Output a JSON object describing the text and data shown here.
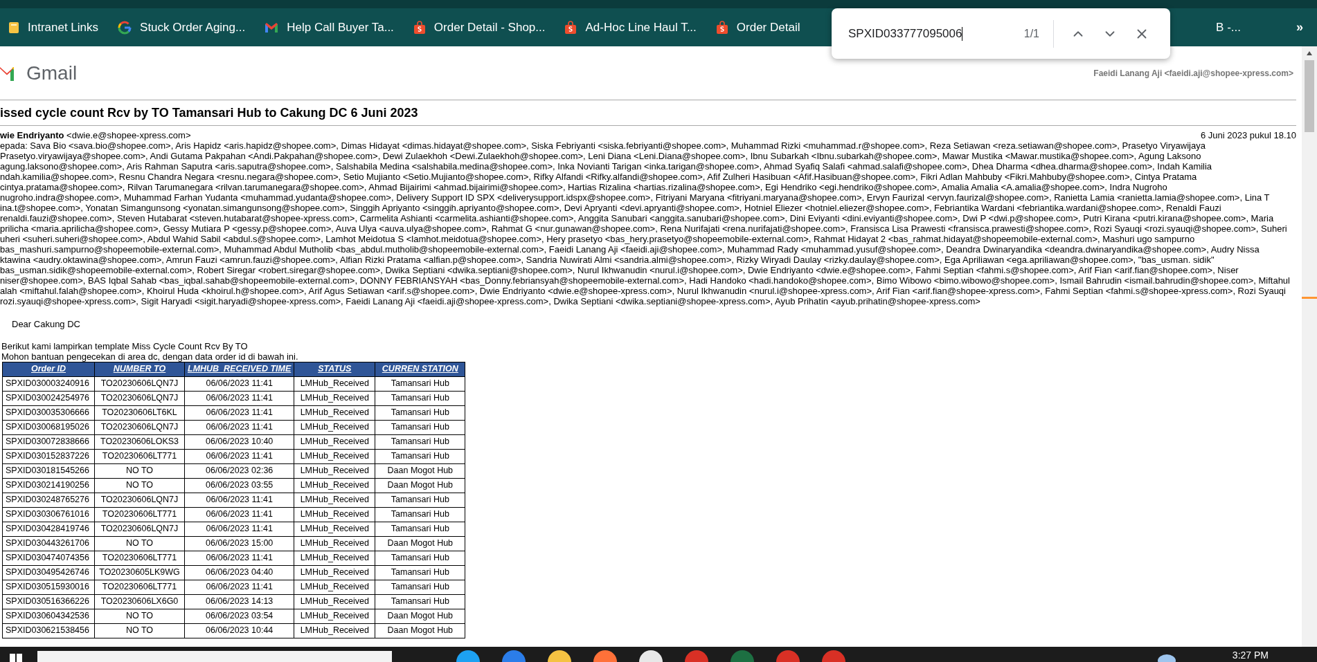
{
  "bookmarks": [
    {
      "kind": "folder",
      "label": "Intranet Links"
    },
    {
      "kind": "google",
      "label": "Stuck Order Aging..."
    },
    {
      "kind": "gmail",
      "label": "Help Call Buyer Ta..."
    },
    {
      "kind": "shop",
      "label": "Order Detail - Shop..."
    },
    {
      "kind": "shop",
      "label": "Ad-Hoc Line Haul T..."
    },
    {
      "kind": "shop",
      "label": "Order Detail"
    }
  ],
  "bookmark_tail": "B -...",
  "bookmark_overflow": "»",
  "find_bar": {
    "query": "SPXID033777095006",
    "count": "1/1"
  },
  "gmail": {
    "brand": "Gmail",
    "account": "Faeidi Lanang Aji <faeidi.aji@shopee-xpress.com>"
  },
  "email": {
    "subject": "issed cycle count Rcv by TO Tamansari Hub to Cakung DC 6 Juni 2023",
    "sender_name": "wie Endriyanto",
    "sender_address": "<dwie.e@shopee-xpress.com>",
    "date": "6 Juni 2023 pukul 18.10",
    "recipient_lines": [
      "epada: Sava Bio <sava.bio@shopee.com>, Aris Hapidz <aris.hapidz@shopee.com>, Dimas Hidayat <dimas.hidayat@shopee.com>, Siska Febriyanti <siska.febriyanti@shopee.com>, Muhammad Rizki <muhammad.r@shopee.com>, Reza Setiawan <reza.setiawan@shopee.com>, Prasetyo Viryawijaya",
      "Prasetyo.viryawijaya@shopee.com>, Andi Gutama Pakpahan <Andi.Pakpahan@shopee.com>, Dewi Zulaekhoh <Dewi.Zulaekhoh@shopee.com>, Leni Diana <Leni.Diana@shopee.com>, Ibnu Subarkah <Ibnu.subarkah@shopee.com>, Mawar Mustika <Mawar.mustika@shopee.com>, Agung Laksono",
      "agung.laksono@shopee.com>, Aris Rahman Saputra <aris.saputra@shopee.com>, Salshabila Medina <salshabila.medina@shopee.com>, Inka Novianti Tarigan <inka.tarigan@shopee.com>, Ahmad Syafiq Salafi <ahmad.salafi@shopee.com>, Dhea Dharma <dhea.dharma@shopee.com>, Indah Kamilia",
      "ndah.kamilia@shopee.com>, Resnu Chandra Negara <resnu.negara@shopee.com>, Setio Mujianto <Setio.Mujianto@shopee.com>, Rifky Alfandi <Rifky.alfandi@shopee.com>, Afif Zulheri Hasibuan <Afif.Hasibuan@shopee.com>, Fikri Adlan Mahbuby <Fikri.Mahbuby@shopee.com>, Cintya Pratama",
      "cintya.pratama@shopee.com>, Rilvan Tarumanegara <rilvan.tarumanegara@shopee.com>, Ahmad Bijairimi <ahmad.bijairimi@shopee.com>, Hartias Rizalina <hartias.rizalina@shopee.com>, Egi Hendriko <egi.hendriko@shopee.com>, Amalia Amalia <A.amalia@shopee.com>, Indra Nugroho",
      "nugroho.indra@shopee.com>, Muhammad Farhan Yudanta <muhammad.yudanta@shopee.com>, Delivery Support ID SPX <deliverysupport.idspx@shopee.com>, Fitriyani Maryana <fitriyani.maryana@shopee.com>, Ervyn Faurizal <ervyn.faurizal@shopee.com>, Ranietta Lamia <ranietta.lamia@shopee.com>, Lina T",
      "ina.t@shopee.com>, Yonatan Simangunsong <yonatan.simangunsong@shopee.com>, Singgih Apriyanto <singgih.apriyanto@shopee.com>, Devi Apryanti <devi.apryanti@shopee.com>, Hotniel Eliezer <hotniel.eliezer@shopee.com>, Febriantika Wardani <febriantika.wardani@shopee.com>, Renaldi Fauzi",
      "renaldi.fauzi@shopee.com>, Steven Hutabarat <steven.hutabarat@shopee-xpress.com>, Carmelita Ashianti <carmelita.ashianti@shopee.com>, Anggita Sanubari <anggita.sanubari@shopee.com>, Dini Eviyanti <dini.eviyanti@shopee.com>, Dwi P <dwi.p@shopee.com>, Putri Kirana <putri.kirana@shopee.com>, Maria",
      "prilicha <maria.aprilicha@shopee.com>, Gessy Mutiara P <gessy.p@shopee.com>, Auva Ulya <auva.ulya@shopee.com>, Rahmat G <nur.gunawan@shopee.com>, Rena Nurifajati <rena.nurifajati@shopee.com>, Fransisca Lisa Prawesti <fransisca.prawesti@shopee.com>, Rozi Syauqi <rozi.syauqi@shopee.com>, Suheri",
      "uheri <suheri.suheri@shopee.com>, Abdul Wahid Sabil <abdul.s@shopee.com>, Lamhot Meidotua S <lamhot.meidotua@shopee.com>, Hery prasetyo <bas_hery.prasetyo@shopeemobile-external.com>, Rahmat Hidayat 2 <bas_rahmat.hidayat@shopeemobile-external.com>, Mashuri ugo sampurno",
      "bas_mashuri.sampurno@shopeemobile-external.com>, Muhammad Abdul Mutholib <bas_abdul.mutholib@shopeemobile-external.com>, Faeidi Lanang Aji <faeidi.aji@shopee.com>, Muhammad Rady <muhammad.yusuf@shopee.com>, Deandra Dwinaryandika <deandra.dwinaryandika@shopee.com>, Audry Nissa",
      "ktawina <audry.oktawina@shopee.com>, Amrun Fauzi <amrun.fauzi@shopee.com>, Alfian Rizki Pratama <alfian.p@shopee.com>, Sandria Nuwirati Almi <sandria.almi@shopee.com>, Rizky Wiryadi Daulay <rizky.daulay@shopee.com>, Ega Apriliawan <ega.apriliawan@shopee.com>, \"bas_usman. sidik\"",
      "bas_usman.sidik@shopeemobile-external.com>, Robert Siregar <robert.siregar@shopee.com>, Dwika Septiani <dwika.septiani@shopee.com>, Nurul Ikhwanudin <nurul.i@shopee.com>, Dwie Endriyanto <dwie.e@shopee.com>, Fahmi Septian <fahmi.s@shopee.com>, Arif Fian <arif.fian@shopee.com>, Niser",
      "niser@shopee.com>, BAS Iqbal Sahab <bas_iqbal.sahab@shopeemobile-external.com>, DONNY FEBRIANSYAH <bas_Donny.febriansyah@shopeemobile-external.com>, Hadi Handoko <hadi.handoko@shopee.com>, Bimo Wibowo <bimo.wibowo@shopee.com>, Ismail Bahrudin <ismail.bahrudin@shopee.com>, Miftahul",
      "alah <miftahul.falah@shopee.com>, Khoirul Huda <khoirul.h@shopee.com>, Arif Agus Setiawan <arif.s@shopee.com>, Dwie Endriyanto <dwie.e@shopee-xpress.com>, Nurul Ikhwanudin <nurul.i@shopee-xpress.com>, Arif Fian <arif.fian@shopee-xpress.com>, Fahmi Septian <fahmi.s@shopee-xpress.com>, Rozi Syauqi",
      "rozi.syauqi@shopee-xpress.com>, Sigit Haryadi <sigit.haryadi@shopee-xpress.com>, Faeidi Lanang Aji <faeidi.aji@shopee-xpress.com>, Dwika Septiani <dwika.septiani@shopee-xpress.com>, Ayub Prihatin <ayub.prihatin@shopee-xpress.com>"
    ],
    "greeting": "Dear Cakung DC",
    "body": [
      "Berikut kami lampirkan template Miss Cycle Count Rcv By TO",
      "Mohon bantuan pengecekan di area dc, dengan data order id di bawah ini."
    ],
    "table": {
      "columns": [
        "Order ID",
        "NUMBER TO",
        "LMHUB_RECEIVED TIME",
        "STATUS",
        "CURREN STATION"
      ],
      "rows": [
        [
          "SPXID030003240916",
          "TO20230606LQN7J",
          "06/06/2023 11:41",
          "LMHub_Received",
          "Tamansari Hub"
        ],
        [
          "SPXID030024254976",
          "TO20230606LQN7J",
          "06/06/2023 11:41",
          "LMHub_Received",
          "Tamansari Hub"
        ],
        [
          "SPXID030035306666",
          "TO20230606LT6KL",
          "06/06/2023 11:41",
          "LMHub_Received",
          "Tamansari Hub"
        ],
        [
          "SPXID030068195026",
          "TO20230606LQN7J",
          "06/06/2023 11:41",
          "LMHub_Received",
          "Tamansari Hub"
        ],
        [
          "SPXID030072838666",
          "TO20230606LOKS3",
          "06/06/2023 10:40",
          "LMHub_Received",
          "Tamansari Hub"
        ],
        [
          "SPXID030152837226",
          "TO20230606LT771",
          "06/06/2023 11:41",
          "LMHub_Received",
          "Tamansari Hub"
        ],
        [
          "SPXID030181545266",
          "NO TO",
          "06/06/2023 02:36",
          "LMHub_Received",
          "Daan Mogot Hub"
        ],
        [
          "SPXID030214190256",
          "NO TO",
          "06/06/2023 03:55",
          "LMHub_Received",
          "Daan Mogot Hub"
        ],
        [
          "SPXID030248765276",
          "TO20230606LQN7J",
          "06/06/2023 11:41",
          "LMHub_Received",
          "Tamansari Hub"
        ],
        [
          "SPXID030306761016",
          "TO20230606LT771",
          "06/06/2023 11:41",
          "LMHub_Received",
          "Tamansari Hub"
        ],
        [
          "SPXID030428419746",
          "TO20230606LQN7J",
          "06/06/2023 11:41",
          "LMHub_Received",
          "Tamansari Hub"
        ],
        [
          "SPXID030443261706",
          "NO TO",
          "06/06/2023 15:00",
          "LMHub_Received",
          "Daan Mogot Hub"
        ],
        [
          "SPXID030474074356",
          "TO20230606LT771",
          "06/06/2023 11:41",
          "LMHub_Received",
          "Tamansari Hub"
        ],
        [
          "SPXID030495426746",
          "TO20230605LK9WG",
          "06/06/2023 04:40",
          "LMHub_Received",
          "Tamansari Hub"
        ],
        [
          "SPXID030515930016",
          "TO20230606LT771",
          "06/06/2023 11:41",
          "LMHub_Received",
          "Tamansari Hub"
        ],
        [
          "SPXID030516366226",
          "TO20230606LX6G0",
          "06/06/2023 14:13",
          "LMHub_Received",
          "Tamansari Hub"
        ],
        [
          "SPXID030604342536",
          "NO TO",
          "06/06/2023 03:54",
          "LMHub_Received",
          "Daan Mogot Hub"
        ],
        [
          "SPXID030621538456",
          "NO TO",
          "06/06/2023 10:44",
          "LMHub_Received",
          "Daan Mogot Hub"
        ]
      ]
    }
  },
  "taskbar": {
    "time": "3:27 PM"
  }
}
